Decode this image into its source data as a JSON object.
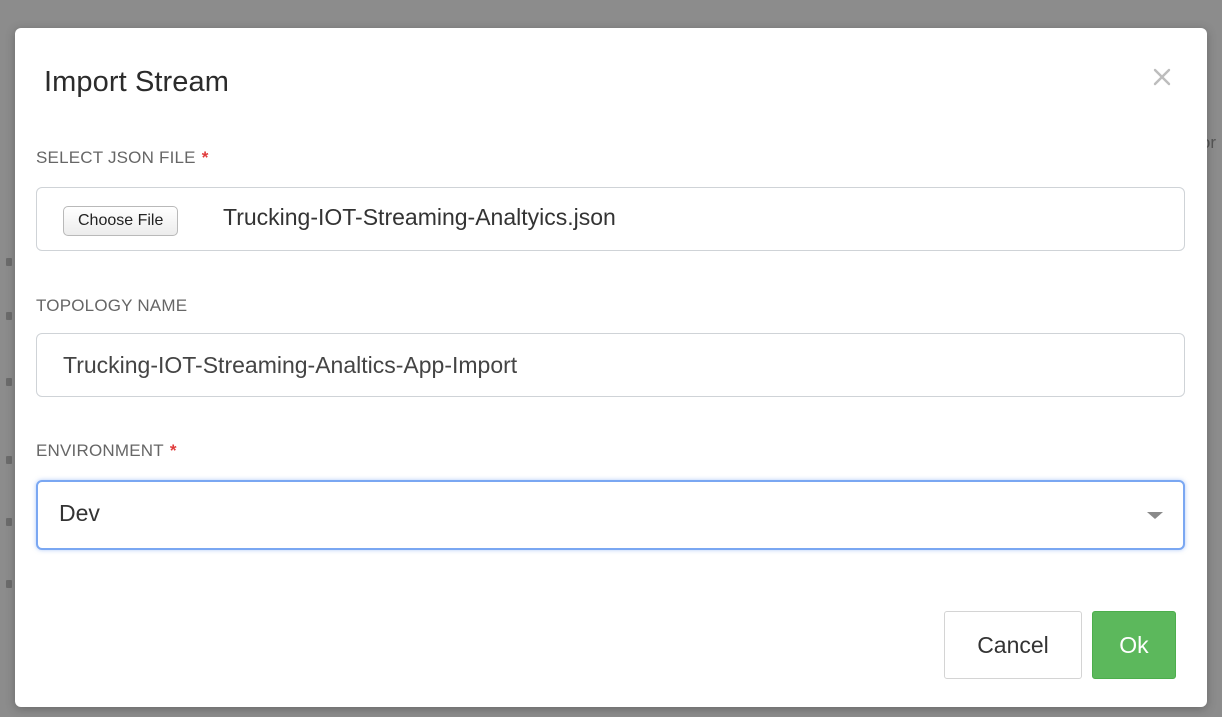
{
  "dialog": {
    "title": "Import Stream",
    "close_icon": "close-icon"
  },
  "background": {
    "partial_text": "or"
  },
  "fields": {
    "json_file": {
      "label": "SELECT JSON FILE",
      "required_marker": "*",
      "button_label": "Choose File",
      "file_name": "Trucking-IOT-Streaming-Analtyics.json"
    },
    "topology_name": {
      "label": "TOPOLOGY NAME",
      "value": "Trucking-IOT-Streaming-Analtics-App-Import"
    },
    "environment": {
      "label": "ENVIRONMENT",
      "required_marker": "*",
      "selected": "Dev",
      "caret_icon": "caret-down-icon"
    }
  },
  "actions": {
    "cancel_label": "Cancel",
    "ok_label": "Ok"
  },
  "colors": {
    "ok_button": "#5cb85c",
    "required_marker": "#e03a3a",
    "focus_border": "#7aa7f2",
    "overlay": "#8c8c8c"
  }
}
